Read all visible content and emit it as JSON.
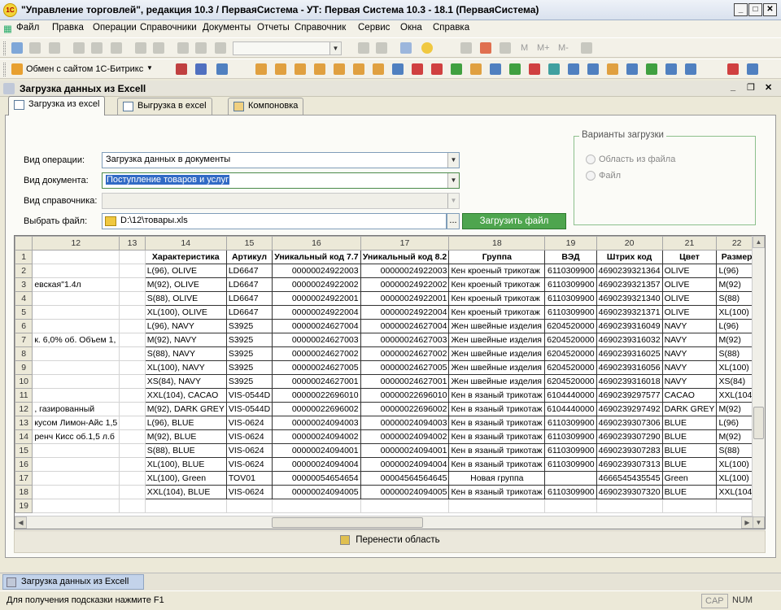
{
  "app": {
    "title": "\"Управление торговлей\", редакция 10.3 / ПерваяСистема - УТ: Первая Система 10.3 - 18.1 (ПерваяСистема)",
    "logo": "1С"
  },
  "menu": [
    "Файл",
    "Правка",
    "Операции",
    "Справочники",
    "Документы",
    "Отчеты",
    "Справочник",
    "Сервис",
    "Окна",
    "Справка"
  ],
  "toolbar": {
    "exchange_label": "Обмен с сайтом 1С-Битрикс",
    "memory": [
      "M",
      "M+",
      "M-"
    ]
  },
  "document": {
    "title": "Загрузка данных из Excell"
  },
  "tabs": [
    "Загрузка из excel",
    "Выгрузка в excel",
    "Компоновка"
  ],
  "form": {
    "operation_label": "Вид операции:",
    "operation_value": "Загрузка данных в документы",
    "doctype_label": "Вид документа:",
    "doctype_value": "Поступление товаров и услуг",
    "dict_label": "Вид справочника:",
    "dict_value": "",
    "file_label": "Выбрать файл:",
    "file_value": "D:\\12\\товары.xls",
    "browse": "...",
    "load_button": "Загрузить файл"
  },
  "load_variants": {
    "title": "Варианты загрузки",
    "options": [
      "Область из файла",
      "Файл"
    ]
  },
  "sheet": {
    "col_headers": [
      "12",
      "13",
      "14",
      "15",
      "16",
      "17",
      "18",
      "19",
      "20",
      "21",
      "22"
    ],
    "rows": [
      [
        "",
        "",
        "Характеристика",
        "Артикул",
        "Уникальный код 7.7",
        "Уникальный код 8.2",
        "Группа",
        "ВЭД",
        "Штрих код",
        "Цвет",
        "Размер"
      ],
      [
        "",
        "",
        "L(96), OLIVE",
        "LD6647",
        "00000024922003",
        "00000024922003",
        "Кен кроеный трикотаж",
        "6110309900",
        "4690239321364",
        "OLIVE",
        "L(96)"
      ],
      [
        "евская\"1.4л",
        "",
        "M(92), OLIVE",
        "LD6647",
        "00000024922002",
        "00000024922002",
        "Кен кроеный трикотаж",
        "6110309900",
        "4690239321357",
        "OLIVE",
        "M(92)"
      ],
      [
        "",
        "",
        "S(88), OLIVE",
        "LD6647",
        "00000024922001",
        "00000024922001",
        "Кен кроеный трикотаж",
        "6110309900",
        "4690239321340",
        "OLIVE",
        "S(88)"
      ],
      [
        "",
        "",
        "XL(100), OLIVE",
        "LD6647",
        "00000024922004",
        "00000024922004",
        "Кен кроеный трикотаж",
        "6110309900",
        "4690239321371",
        "OLIVE",
        "XL(100)"
      ],
      [
        "",
        "",
        "L(96), NAVY",
        "S3925",
        "00000024627004",
        "00000024627004",
        "Жен швейные изделия",
        "6204520000",
        "4690239316049",
        "NAVY",
        "L(96)"
      ],
      [
        "к. 6,0% об. Объем 1,",
        "",
        "M(92), NAVY",
        "S3925",
        "00000024627003",
        "00000024627003",
        "Жен швейные изделия",
        "6204520000",
        "4690239316032",
        "NAVY",
        "M(92)"
      ],
      [
        "",
        "",
        "S(88), NAVY",
        "S3925",
        "00000024627002",
        "00000024627002",
        "Жен швейные изделия",
        "6204520000",
        "4690239316025",
        "NAVY",
        "S(88)"
      ],
      [
        "",
        "",
        "XL(100), NAVY",
        "S3925",
        "00000024627005",
        "00000024627005",
        "Жен швейные изделия",
        "6204520000",
        "4690239316056",
        "NAVY",
        "XL(100)"
      ],
      [
        "",
        "",
        "XS(84), NAVY",
        "S3925",
        "00000024627001",
        "00000024627001",
        "Жен швейные изделия",
        "6204520000",
        "4690239316018",
        "NAVY",
        "XS(84)"
      ],
      [
        "",
        "",
        "XXL(104), CACAO",
        "VIS-0544D",
        "00000022696010",
        "00000022696010",
        "Кен в язаный трикотаж",
        "6104440000",
        "4690239297577",
        "CACAO",
        "XXL(104)"
      ],
      [
        ", газированный",
        "",
        "M(92), DARK GREY",
        "VIS-0544D",
        "00000022696002",
        "00000022696002",
        "Кен в язаный трикотаж",
        "6104440000",
        "4690239297492",
        "DARK GREY",
        "M(92)"
      ],
      [
        "кусом  Лимон-Айс 1,5",
        "",
        "L(96), BLUE",
        "VIS-0624",
        "00000024094003",
        "00000024094003",
        "Кен в язаный трикотаж",
        "6110309900",
        "4690239307306",
        "BLUE",
        "L(96)"
      ],
      [
        "ренч Кисс об.1,5 л.б",
        "",
        "M(92), BLUE",
        "VIS-0624",
        "00000024094002",
        "00000024094002",
        "Кен в язаный трикотаж",
        "6110309900",
        "4690239307290",
        "BLUE",
        "M(92)"
      ],
      [
        "",
        "",
        "S(88), BLUE",
        "VIS-0624",
        "00000024094001",
        "00000024094001",
        "Кен в язаный трикотаж",
        "6110309900",
        "4690239307283",
        "BLUE",
        "S(88)"
      ],
      [
        "",
        "",
        "XL(100), BLUE",
        "VIS-0624",
        "00000024094004",
        "00000024094004",
        "Кен в язаный трикотаж",
        "6110309900",
        "4690239307313",
        "BLUE",
        "XL(100)"
      ],
      [
        "",
        "",
        "XL(100), Green",
        "TOV01",
        "00000054654654",
        "00004564564645",
        "Новая группа",
        "",
        "4666545435545",
        "Green",
        "XL(100)"
      ],
      [
        "",
        "",
        "XXL(104), BLUE",
        "VIS-0624",
        "00000024094005",
        "00000024094005",
        "Кен в язаный трикотаж",
        "6110309900",
        "4690239307320",
        "BLUE",
        "XXL(104)"
      ],
      [
        "",
        "",
        "",
        "",
        "",
        "",
        "",
        "",
        "",
        "",
        ""
      ]
    ]
  },
  "move_area_button": "Перенести область",
  "taskbar_item": "Загрузка данных из Excell",
  "status": {
    "hint": "Для получения подсказки нажмите F1",
    "cap": "CAP",
    "num": "NUM"
  }
}
